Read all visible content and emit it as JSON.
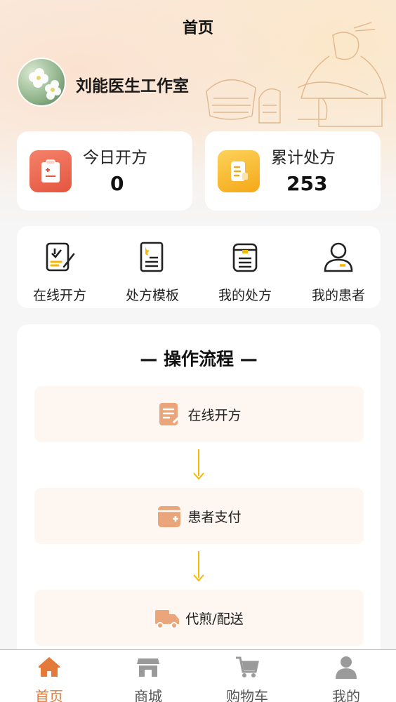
{
  "header": {
    "title": "首页"
  },
  "profile": {
    "studio_name": "刘能医生工作室",
    "avatar_icon": "flower-avatar"
  },
  "stats": [
    {
      "label": "今日开方",
      "value": "0",
      "icon": "clipboard-icon",
      "color": "#ea6a4f"
    },
    {
      "label": "累计处方",
      "value": "253",
      "icon": "document-icon",
      "color": "#f7b733"
    }
  ],
  "quick_actions": [
    {
      "label": "在线开方",
      "icon": "sign-prescription-icon"
    },
    {
      "label": "处方模板",
      "icon": "template-icon"
    },
    {
      "label": "我的处方",
      "icon": "prescription-list-icon"
    },
    {
      "label": "我的患者",
      "icon": "patient-icon"
    }
  ],
  "flow": {
    "title": "— 操作流程 —",
    "steps": [
      {
        "label": "在线开方",
        "icon": "note-icon"
      },
      {
        "label": "患者支付",
        "icon": "wallet-icon"
      },
      {
        "label": "代煎/配送",
        "icon": "truck-icon"
      }
    ]
  },
  "tabbar": {
    "items": [
      {
        "label": "首页",
        "icon": "home-icon",
        "active": true
      },
      {
        "label": "商城",
        "icon": "shop-icon",
        "active": false
      },
      {
        "label": "购物车",
        "icon": "cart-icon",
        "active": false
      },
      {
        "label": "我的",
        "icon": "user-icon",
        "active": false
      }
    ]
  },
  "colors": {
    "accent": "#e47a3a",
    "flow_arrow": "#f5b800",
    "step_bg": "#fdf6f1",
    "icon_peach": "#eaa57a"
  }
}
